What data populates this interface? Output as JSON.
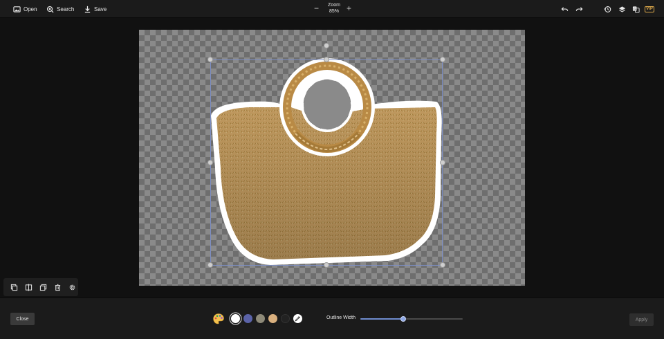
{
  "toolbar": {
    "open_label": "Open",
    "search_label": "Search",
    "save_label": "Save",
    "zoom_label": "Zoom",
    "zoom_value": "85%",
    "zoom_out_symbol": "−",
    "zoom_in_symbol": "+",
    "right_icons": [
      "undo-icon",
      "redo-icon",
      "history-icon",
      "layers-icon",
      "translate-icon"
    ],
    "vip_label": "VIP"
  },
  "minibar": {
    "icons": [
      "duplicate-icon",
      "flip-icon",
      "arrange-icon",
      "delete-icon",
      "settings-icon"
    ]
  },
  "bottom": {
    "close_label": "Close",
    "apply_label": "Apply",
    "palette_icon": "palette-icon",
    "swatches": [
      {
        "name": "white",
        "color": "#ffffff",
        "selected": true
      },
      {
        "name": "blue",
        "color": "#5b63a8",
        "selected": false
      },
      {
        "name": "gray-green",
        "color": "#8e8a78",
        "selected": false
      },
      {
        "name": "tan",
        "color": "#d9b07e",
        "selected": false
      },
      {
        "name": "black",
        "color": "#222222",
        "selected": false
      }
    ],
    "eyedropper_icon": "eyedropper-icon",
    "outline_width_label": "Outline Width",
    "outline_width_value": 0.42
  },
  "colors": {
    "accent": "#6f8dd0",
    "selection": "#7c8ec4",
    "vip": "#d9a64a",
    "basket": "#c9a063",
    "outline": "#ffffff"
  }
}
